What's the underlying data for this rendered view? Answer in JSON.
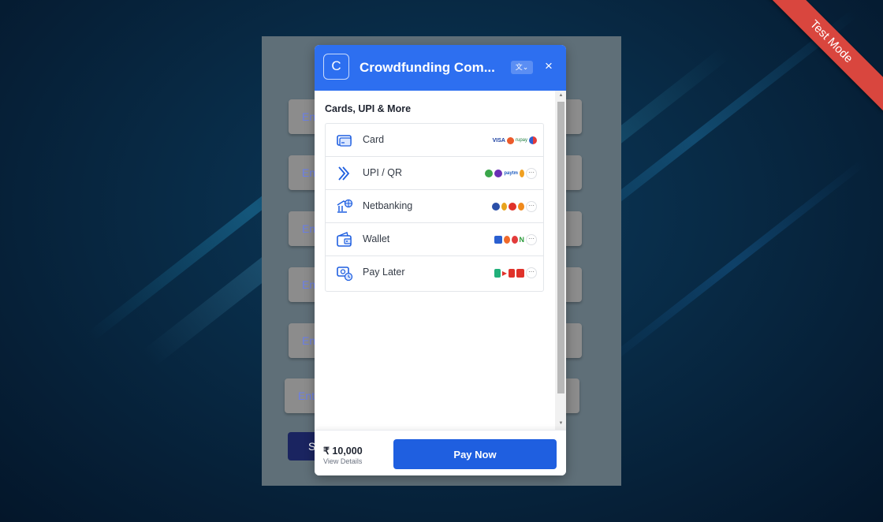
{
  "badge": {
    "label": "Test Mode"
  },
  "host_form": {
    "field_placeholder": "Ent",
    "submit_label": "S"
  },
  "checkout": {
    "logo_letter": "C",
    "merchant_name": "Crowdfunding Com...",
    "language_icon": "language-icon",
    "close_label": "×",
    "section_title": "Cards, UPI & More",
    "methods": [
      {
        "label": "Card",
        "icon": "card-icon"
      },
      {
        "label": "UPI / QR",
        "icon": "upi-icon"
      },
      {
        "label": "Netbanking",
        "icon": "bank-icon"
      },
      {
        "label": "Wallet",
        "icon": "wallet-icon"
      },
      {
        "label": "Pay Later",
        "icon": "pay-later-icon"
      }
    ],
    "more_label": "···",
    "amount": "₹ 10,000",
    "view_details": "View Details",
    "pay_button": "Pay Now"
  },
  "colors": {
    "accent": "#2d6ff0",
    "pay_button": "#1f5fe0",
    "ribbon": "#d9463e"
  }
}
